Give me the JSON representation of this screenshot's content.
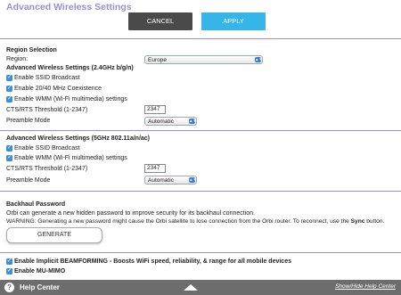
{
  "header": {
    "title": "Advanced Wireless Settings",
    "cancel": "CANCEL",
    "apply": "APPLY"
  },
  "region": {
    "section_title": "Region Selection",
    "label": "Region:",
    "value": "Europe"
  },
  "band24": {
    "title": "Advanced Wireless Settings (2.4GHz b/g/n)",
    "ssid_broadcast": "Enable SSID Broadcast",
    "coexistence": "Enable 20/40 MHz Coexistence",
    "wmm": "Enable WMM (Wi-Fi multimedia) settings",
    "cts_label": "CTS/RTS Threshold (1-2347)",
    "cts_value": "2347",
    "preamble_label": "Preamble Mode",
    "preamble_value": "Automatic"
  },
  "band5": {
    "title": "Advanced Wireless Settings (5GHz 802.11a/n/ac)",
    "ssid_broadcast": "Enable SSID Broadcast",
    "wmm": "Enable WMM (Wi-Fi multimedia) settings",
    "cts_label": "CTS/RTS Threshold (1-2347)",
    "cts_value": "2347",
    "preamble_label": "Preamble Mode",
    "preamble_value": "Automatic"
  },
  "backhaul": {
    "title": "Backhaul Password",
    "desc1": "Orbi can generate a new hidden password to improve security for its backhaul connection.",
    "desc2_a": "WARNING: Generating a new password might cause the Orbi satellite to lose connection from the Orbi router. To reconnect, use the ",
    "desc2_b": "Sync",
    "desc2_c": " button.",
    "generate": "GENERATE"
  },
  "options": {
    "beamforming": "Enable Implicit BEAMFORMING - Boosts WiFi speed, reliability, & range for all mobile devices",
    "mumimo": "Enable MU-MIMO"
  },
  "footer": {
    "help_icon": "?",
    "title": "Help Center",
    "link": "Show/Hide Help Center"
  },
  "colors": {
    "accent": "#9b8fd9",
    "apply": "#35b5e8",
    "cancel": "#4a4a4a",
    "checkbox": "#3a8fe0",
    "footer": "#6d6d6d"
  }
}
